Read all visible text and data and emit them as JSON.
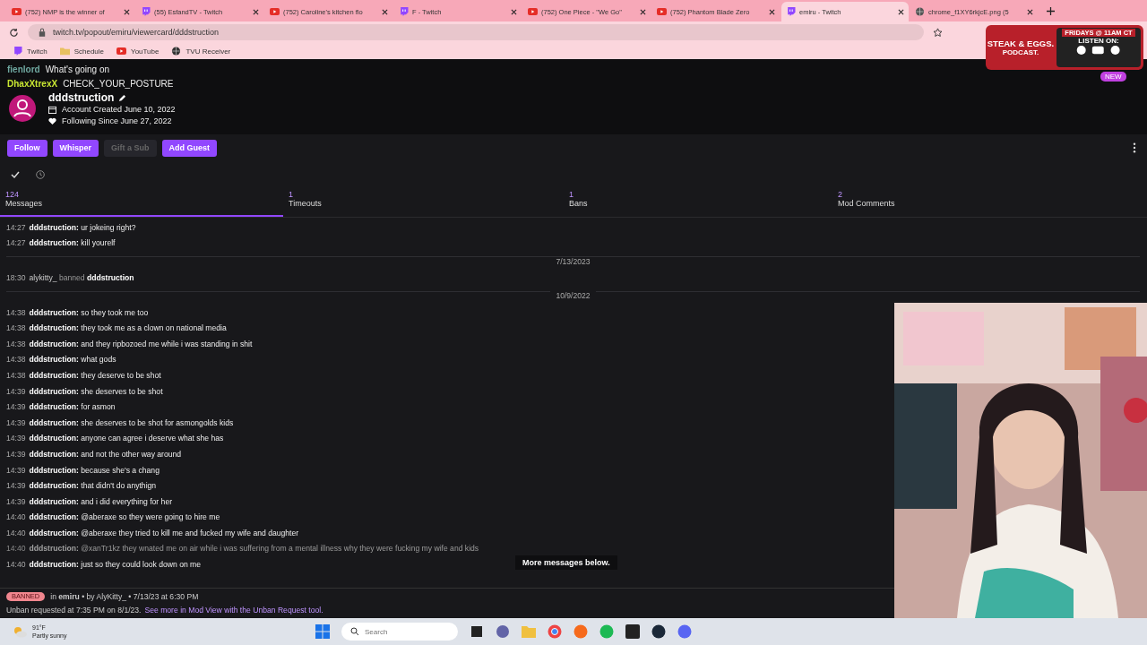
{
  "browser": {
    "tabs": [
      {
        "title": "(752) NMP is the winner of",
        "selected": false
      },
      {
        "title": "(55) EsfandTV - Twitch",
        "selected": false
      },
      {
        "title": "(752) Caroline's kitchen flo",
        "selected": false
      },
      {
        "title": "F - Twitch",
        "selected": false
      },
      {
        "title": "(752) One Piece - \"We Go\"",
        "selected": false
      },
      {
        "title": "(752) Phantom Blade Zero",
        "selected": false
      },
      {
        "title": "emiru - Twitch",
        "selected": true
      },
      {
        "title": "chrome_f1XY6rkjcE.png (5",
        "selected": false
      }
    ],
    "address": "twitch.tv/popout/emiru/viewercard/dddstruction",
    "bookmarks": [
      {
        "label": "Twitch"
      },
      {
        "label": "Schedule"
      },
      {
        "label": "YouTube"
      },
      {
        "label": "TVU Receiver"
      }
    ]
  },
  "chat_overlay": [
    {
      "user": "fienlord",
      "text": "What's going on",
      "color": "#6fa8a0"
    },
    {
      "user": "DhaxXtrexX",
      "text": "CHECK_YOUR_POSTURE",
      "color": "#c8e632"
    }
  ],
  "user_card": {
    "name": "dddstruction",
    "account_created": "Account Created June 10, 2022",
    "following_since": "Following Since June 27, 2022",
    "buttons": [
      {
        "label": "Follow",
        "disabled": false
      },
      {
        "label": "Whisper",
        "disabled": false
      },
      {
        "label": "Gift a Sub",
        "disabled": true
      },
      {
        "label": "Add Guest",
        "disabled": false
      }
    ]
  },
  "stats": [
    {
      "count": "124",
      "label": "Messages",
      "selected": true
    },
    {
      "count": "1",
      "label": "Timeouts",
      "selected": false
    },
    {
      "count": "1",
      "label": "Bans",
      "selected": false
    },
    {
      "count": "2",
      "label": "Mod Comments",
      "selected": false
    }
  ],
  "log": [
    {
      "kind": "message",
      "time": "14:27",
      "user": "dddstruction:",
      "text": "ur jokeing right?",
      "faded": false
    },
    {
      "kind": "message",
      "time": "14:27",
      "user": "dddstruction:",
      "text": "kill yourelf",
      "faded": false
    },
    {
      "kind": "date",
      "text": "7/13/2023"
    },
    {
      "kind": "mod_action",
      "time": "18:30",
      "moderator": "alykitty_",
      "action": "banned",
      "user": "dddstruction"
    },
    {
      "kind": "date",
      "text": "10/9/2022"
    },
    {
      "kind": "message",
      "time": "14:38",
      "user": "dddstruction:",
      "text": "so they took me too",
      "faded": false
    },
    {
      "kind": "message",
      "time": "14:38",
      "user": "dddstruction:",
      "text": "they took me as a clown on national media",
      "faded": false
    },
    {
      "kind": "message",
      "time": "14:38",
      "user": "dddstruction:",
      "text": "and they ripbozoed me while i was standing in shit",
      "faded": false
    },
    {
      "kind": "message",
      "time": "14:38",
      "user": "dddstruction:",
      "text": "what gods",
      "faded": false
    },
    {
      "kind": "message",
      "time": "14:38",
      "user": "dddstruction:",
      "text": "they deserve to be shot",
      "faded": false
    },
    {
      "kind": "message",
      "time": "14:39",
      "user": "dddstruction:",
      "text": "she deserves to be shot",
      "faded": false
    },
    {
      "kind": "message",
      "time": "14:39",
      "user": "dddstruction:",
      "text": "for asmon",
      "faded": false
    },
    {
      "kind": "message",
      "time": "14:39",
      "user": "dddstruction:",
      "text": "she deserves to be shot for asmongolds kids",
      "faded": false
    },
    {
      "kind": "message",
      "time": "14:39",
      "user": "dddstruction:",
      "text": "anyone can agree i deserve what she has",
      "faded": false
    },
    {
      "kind": "message",
      "time": "14:39",
      "user": "dddstruction:",
      "text": "and not the other way around",
      "faded": false
    },
    {
      "kind": "message",
      "time": "14:39",
      "user": "dddstruction:",
      "text": "because she's a chang",
      "faded": false
    },
    {
      "kind": "message",
      "time": "14:39",
      "user": "dddstruction:",
      "text": "that didn't do anythign",
      "faded": false
    },
    {
      "kind": "message",
      "time": "14:39",
      "user": "dddstruction:",
      "text": "and i did everything for her",
      "faded": false
    },
    {
      "kind": "message",
      "time": "14:40",
      "user": "dddstruction:",
      "text": "@aberaxe so they were going to hire me",
      "faded": false
    },
    {
      "kind": "message",
      "time": "14:40",
      "user": "dddstruction:",
      "text": "@aberaxe they tried to kill me and fucked my wife and daughter",
      "faded": false
    },
    {
      "kind": "message",
      "time": "14:40",
      "user": "dddstruction:",
      "text": "@xanTr1kz they wnated me on air while i was suffering from a mental illness why they were fucking my wife and kids",
      "faded": true
    },
    {
      "kind": "message",
      "time": "14:40",
      "user": "dddstruction:",
      "text": "just so they could look down on me",
      "faded": false
    }
  ],
  "more_messages": "More messages below.",
  "ban": {
    "badge": "BANNED",
    "detail": "in **emiru** • by AlyKitty_ • 7/13/23 at 6:30 PM",
    "unban": "Unban requested at 7:35 PM on 8/1/23.",
    "link": "See more in Mod View with the Unban Request tool."
  },
  "overlay": {
    "name": "STEAK & EGGS.",
    "sub": "PODCAST.",
    "schedule": "FRIDAYS @ 11AM CT",
    "listen": "LISTEN ON:",
    "badge": "NEW"
  },
  "taskbar": {
    "temp": "91°F",
    "weather": "Partly sunny",
    "search_placeholder": "Search"
  }
}
